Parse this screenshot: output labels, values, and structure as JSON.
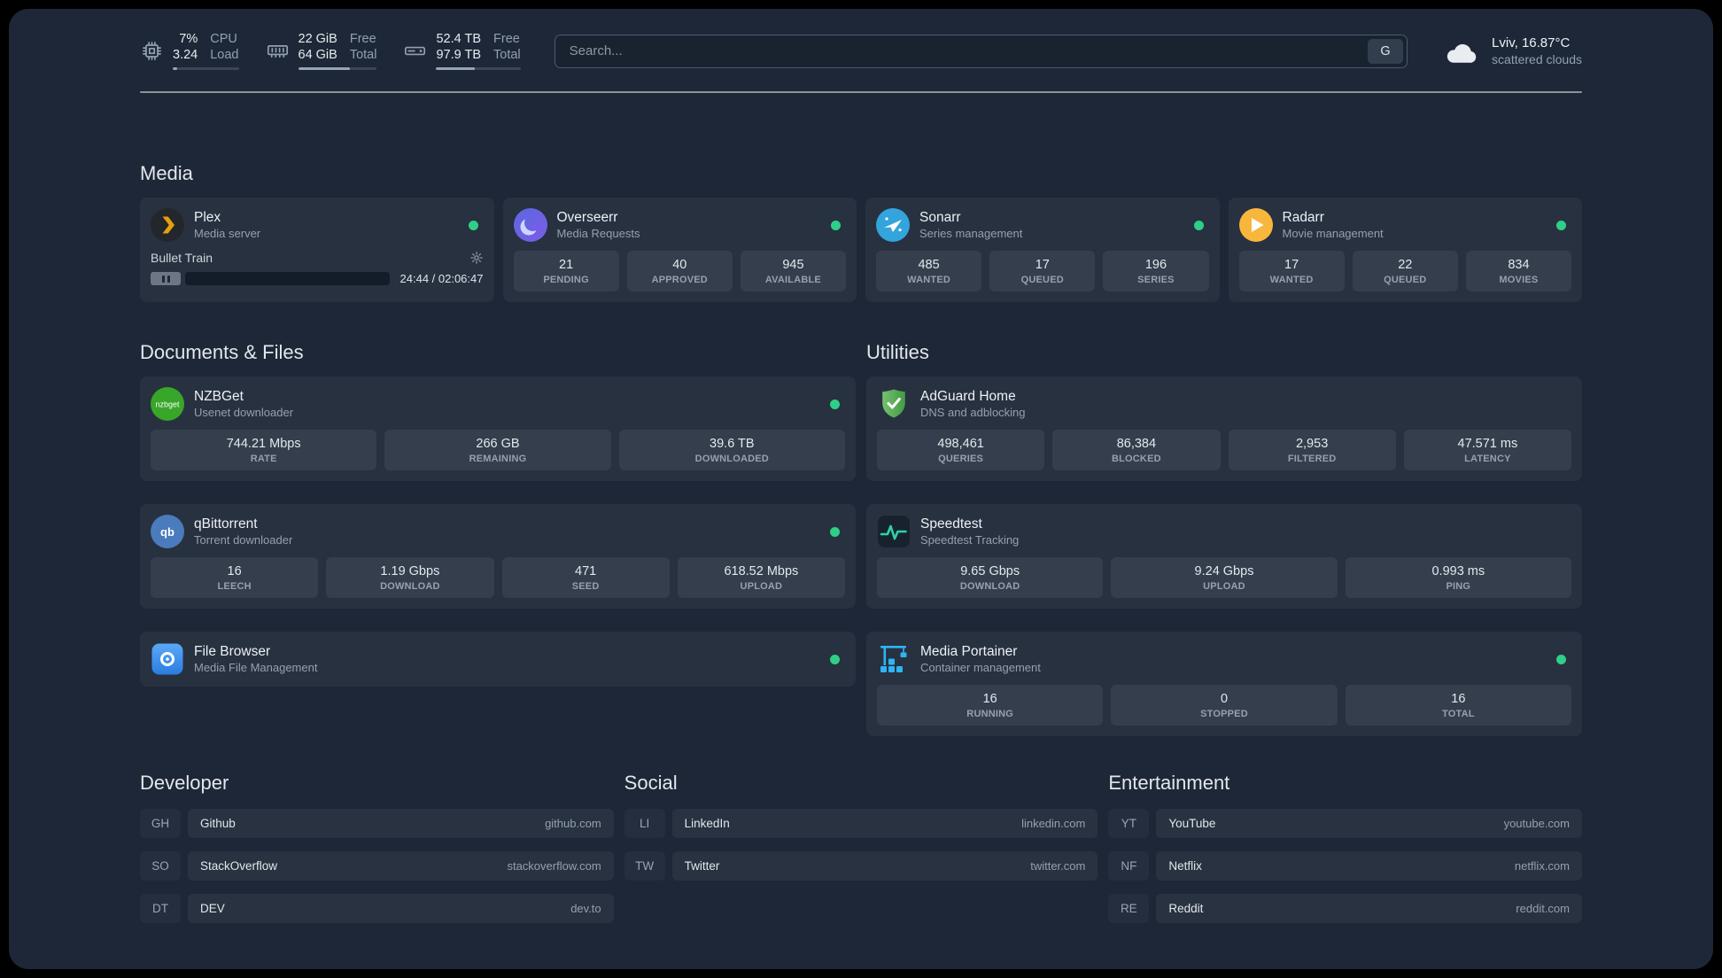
{
  "topbar": {
    "cpu": {
      "value_top": "7%",
      "value_bottom": "3.24",
      "label_top": "CPU",
      "label_bottom": "Load",
      "progress": 7
    },
    "memory": {
      "value_top": "22 GiB",
      "value_bottom": "64 GiB",
      "label_top": "Free",
      "label_bottom": "Total",
      "progress": 66
    },
    "disk": {
      "value_top": "52.4 TB",
      "value_bottom": "97.9 TB",
      "label_top": "Free",
      "label_bottom": "Total",
      "progress": 46
    },
    "search": {
      "placeholder": "Search...",
      "provider_label": "G"
    },
    "weather": {
      "location": "Lviv, 16.87°C",
      "condition": "scattered clouds"
    }
  },
  "media": {
    "title": "Media",
    "plex": {
      "name": "Plex",
      "desc": "Media server",
      "now_playing": "Bullet Train",
      "time": "24:44 / 02:06:47",
      "progress": 19.5
    },
    "overseerr": {
      "name": "Overseerr",
      "desc": "Media Requests",
      "stats": [
        {
          "value": "21",
          "label": "PENDING"
        },
        {
          "value": "40",
          "label": "APPROVED"
        },
        {
          "value": "945",
          "label": "AVAILABLE"
        }
      ]
    },
    "sonarr": {
      "name": "Sonarr",
      "desc": "Series management",
      "stats": [
        {
          "value": "485",
          "label": "WANTED"
        },
        {
          "value": "17",
          "label": "QUEUED"
        },
        {
          "value": "196",
          "label": "SERIES"
        }
      ]
    },
    "radarr": {
      "name": "Radarr",
      "desc": "Movie management",
      "stats": [
        {
          "value": "17",
          "label": "WANTED"
        },
        {
          "value": "22",
          "label": "QUEUED"
        },
        {
          "value": "834",
          "label": "MOVIES"
        }
      ]
    }
  },
  "documents": {
    "title": "Documents & Files",
    "nzbget": {
      "name": "NZBGet",
      "desc": "Usenet downloader",
      "stats": [
        {
          "value": "744.21 Mbps",
          "label": "RATE"
        },
        {
          "value": "266 GB",
          "label": "REMAINING"
        },
        {
          "value": "39.6 TB",
          "label": "DOWNLOADED"
        }
      ]
    },
    "qbittorrent": {
      "name": "qBittorrent",
      "desc": "Torrent downloader",
      "stats": [
        {
          "value": "16",
          "label": "LEECH"
        },
        {
          "value": "1.19 Gbps",
          "label": "DOWNLOAD"
        },
        {
          "value": "471",
          "label": "SEED"
        },
        {
          "value": "618.52 Mbps",
          "label": "UPLOAD"
        }
      ]
    },
    "filebrowser": {
      "name": "File Browser",
      "desc": "Media File Management"
    }
  },
  "utilities": {
    "title": "Utilities",
    "adguard": {
      "name": "AdGuard Home",
      "desc": "DNS and adblocking",
      "stats": [
        {
          "value": "498,461",
          "label": "QUERIES"
        },
        {
          "value": "86,384",
          "label": "BLOCKED"
        },
        {
          "value": "2,953",
          "label": "FILTERED"
        },
        {
          "value": "47.571 ms",
          "label": "LATENCY"
        }
      ]
    },
    "speedtest": {
      "name": "Speedtest",
      "desc": "Speedtest Tracking",
      "stats": [
        {
          "value": "9.65 Gbps",
          "label": "DOWNLOAD"
        },
        {
          "value": "9.24 Gbps",
          "label": "UPLOAD"
        },
        {
          "value": "0.993 ms",
          "label": "PING"
        }
      ]
    },
    "portainer": {
      "name": "Media Portainer",
      "desc": "Container management",
      "stats": [
        {
          "value": "16",
          "label": "RUNNING"
        },
        {
          "value": "0",
          "label": "STOPPED"
        },
        {
          "value": "16",
          "label": "TOTAL"
        }
      ]
    }
  },
  "bookmarks": [
    {
      "title": "Developer",
      "items": [
        {
          "abbr": "GH",
          "name": "Github",
          "domain": "github.com"
        },
        {
          "abbr": "SO",
          "name": "StackOverflow",
          "domain": "stackoverflow.com"
        },
        {
          "abbr": "DT",
          "name": "DEV",
          "domain": "dev.to"
        }
      ]
    },
    {
      "title": "Social",
      "items": [
        {
          "abbr": "LI",
          "name": "LinkedIn",
          "domain": "linkedin.com"
        },
        {
          "abbr": "TW",
          "name": "Twitter",
          "domain": "twitter.com"
        }
      ]
    },
    {
      "title": "Entertainment",
      "items": [
        {
          "abbr": "YT",
          "name": "YouTube",
          "domain": "youtube.com"
        },
        {
          "abbr": "NF",
          "name": "Netflix",
          "domain": "netflix.com"
        },
        {
          "abbr": "RE",
          "name": "Reddit",
          "domain": "reddit.com"
        }
      ]
    }
  ],
  "colors": {
    "status_online": "#2fcf87",
    "accent_green": "#2ed3a3"
  }
}
